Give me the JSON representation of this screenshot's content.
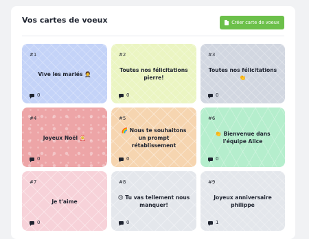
{
  "header": {
    "title": "Vos cartes de voeux",
    "create_button_label": "Créer carte de voeux"
  },
  "cards": [
    {
      "number": "#1",
      "message": "Vive les mariés 🤵",
      "comments": "0",
      "color": "#c4d3f8",
      "pattern": "p-diag"
    },
    {
      "number": "#2",
      "message": "Toutes nos félicitations pierre!",
      "comments": "0",
      "color": "#ebf5c2",
      "pattern": "p-diag"
    },
    {
      "number": "#3",
      "message": "Toutes nos félicitations 👏",
      "comments": "0",
      "color": "#d2d7e1",
      "pattern": "p-diag"
    },
    {
      "number": "#4",
      "message": "Joyeux Noël 🤶",
      "comments": "0",
      "color": "#eda5a7",
      "pattern": "p-dots"
    },
    {
      "number": "#5",
      "message": "🌈 Nous te souhaitons un prompt rétablissement",
      "comments": "0",
      "color": "#f6d5b0",
      "pattern": "p-grid"
    },
    {
      "number": "#6",
      "message": "👏 Bienvenue dans l'équipe Alice",
      "comments": "0",
      "color": "#b5eecd",
      "pattern": "p-gem"
    },
    {
      "number": "#7",
      "message": "Je t'aime",
      "comments": "0",
      "color": "#f7d2d9",
      "pattern": "p-grid"
    },
    {
      "number": "#8",
      "message": "😢 Tu vas tellement nous manquer!",
      "comments": "0",
      "color": "#e4e7ec",
      "pattern": "p-grid"
    },
    {
      "number": "#9",
      "message": "Joyeux anniversaire philippe",
      "comments": "1",
      "color": "#e4e7ec",
      "pattern": "p-diag"
    }
  ],
  "colors": {
    "accent": "#6cc04a",
    "background": "#f1f2f4",
    "panel": "#ffffff",
    "text": "#1f2430"
  },
  "icons": {
    "create_button": "document-icon",
    "comments": "comment-icon"
  }
}
